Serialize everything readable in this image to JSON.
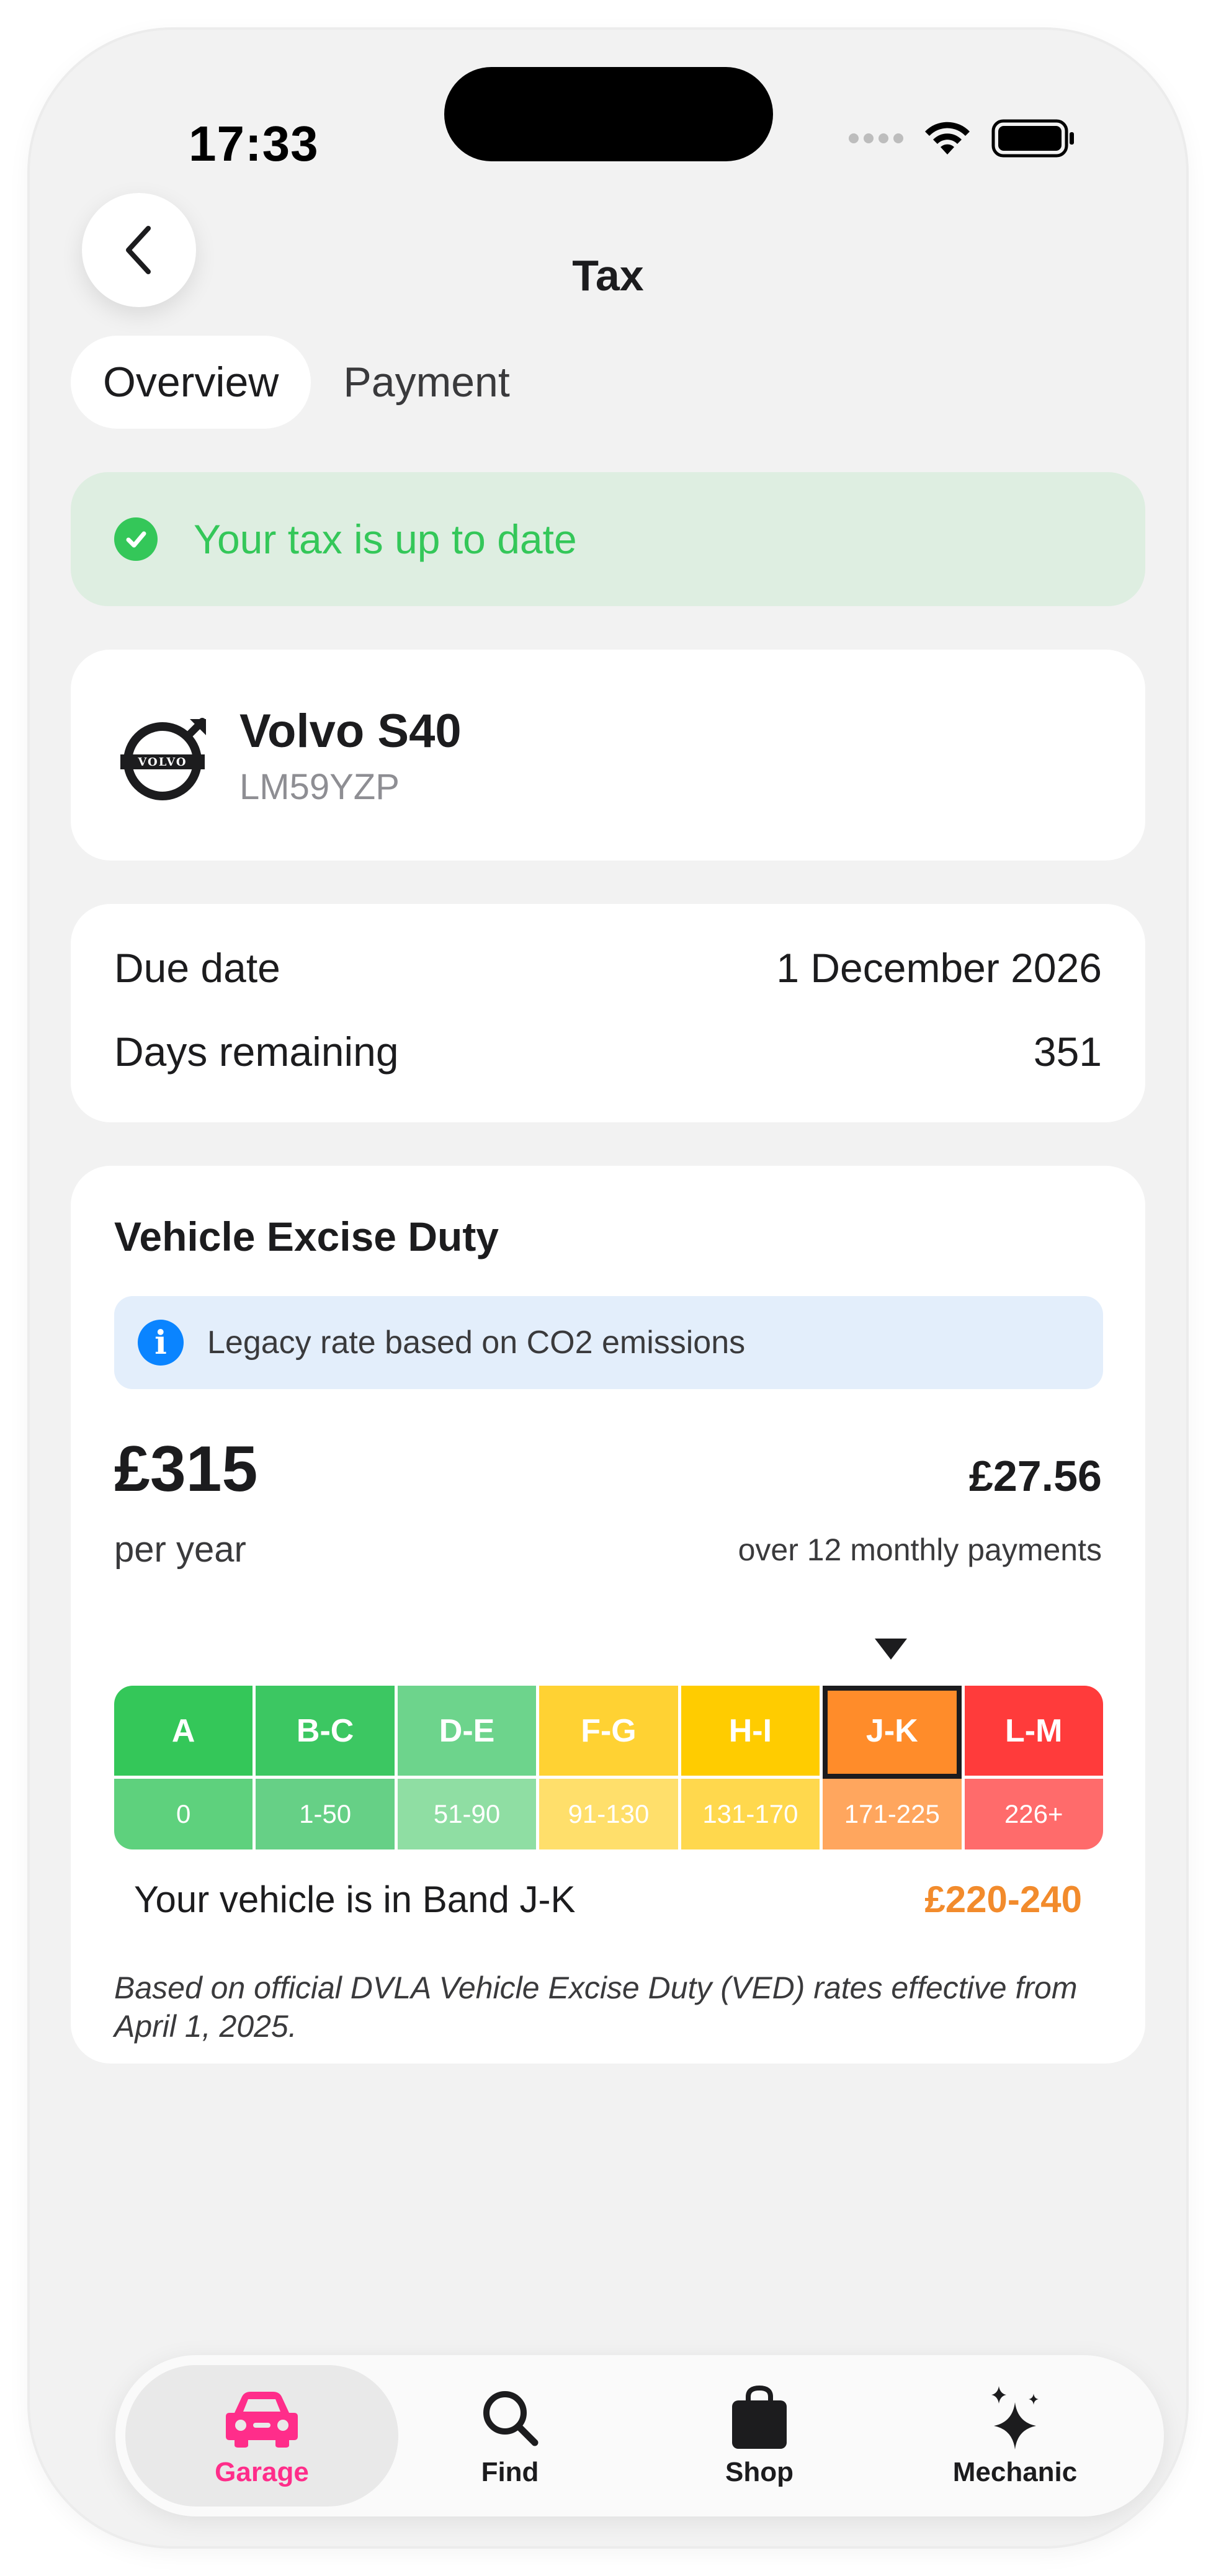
{
  "status_bar": {
    "time": "17:33"
  },
  "header": {
    "title": "Tax"
  },
  "tabs": [
    {
      "label": "Overview",
      "active": true
    },
    {
      "label": "Payment",
      "active": false
    }
  ],
  "status_banner": {
    "text": "Your tax is up to date",
    "color": "#34c759"
  },
  "vehicle": {
    "name": "Volvo S40",
    "registration": "LM59YZP",
    "logo_text": "VOLVO"
  },
  "due": {
    "due_date_label": "Due date",
    "due_date_value": "1 December 2026",
    "days_remaining_label": "Days remaining",
    "days_remaining_value": "351"
  },
  "ved": {
    "title": "Vehicle Excise Duty",
    "info_text": "Legacy rate based on CO2 emissions",
    "annual_price": "£315",
    "annual_label": "per year",
    "monthly_price": "£27.56",
    "monthly_label": "over 12 monthly payments",
    "bands": [
      {
        "name": "A",
        "range": "0",
        "color": "#34c759",
        "range_color": "#5ed17d"
      },
      {
        "name": "B-C",
        "range": "1-50",
        "color": "#3cc762",
        "range_color": "#66d086"
      },
      {
        "name": "D-E",
        "range": "51-90",
        "color": "#6dd48c",
        "range_color": "#8fdea3"
      },
      {
        "name": "F-G",
        "range": "91-130",
        "color": "#ffd233",
        "range_color": "#ffdf6b"
      },
      {
        "name": "H-I",
        "range": "131-170",
        "color": "#ffcc00",
        "range_color": "#ffd84d"
      },
      {
        "name": "J-K",
        "range": "171-225",
        "color": "#ff8c2a",
        "range_color": "#ffa65e"
      },
      {
        "name": "L-M",
        "range": "226+",
        "color": "#ff3b3b",
        "range_color": "#ff6b6b"
      }
    ],
    "current_band_index": 5,
    "band_text": "Your vehicle is in Band J-K",
    "band_price": "£220-240",
    "disclaimer": "Based on official DVLA Vehicle Excise Duty (VED) rates effective from April 1, 2025."
  },
  "nav": [
    {
      "label": "Garage",
      "icon": "car-icon",
      "active": true
    },
    {
      "label": "Find",
      "icon": "search-icon",
      "active": false
    },
    {
      "label": "Shop",
      "icon": "shopping-bag-icon",
      "active": false
    },
    {
      "label": "Mechanic",
      "icon": "sparkles-icon",
      "active": false
    }
  ],
  "colors": {
    "accent": "#ff2d8a",
    "success": "#34c759",
    "band_price": "#f28b2c",
    "info": "#0a84ff"
  }
}
